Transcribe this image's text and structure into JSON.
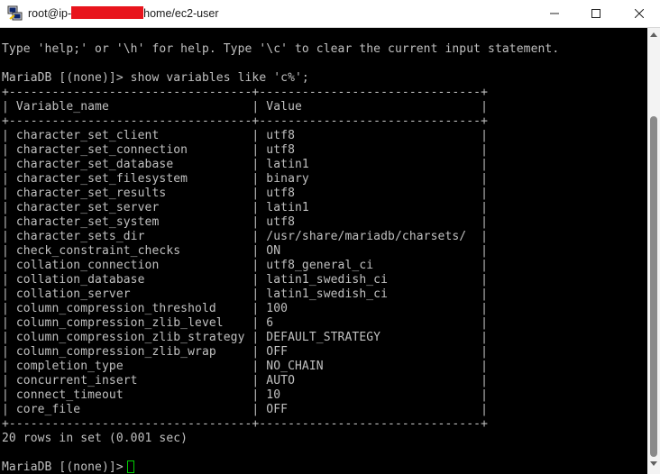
{
  "window": {
    "title_prefix": "root@ip-",
    "title_suffix": "home/ec2-user",
    "icon": "putty-icon"
  },
  "terminal": {
    "lines": [
      "",
      "Type 'help;' or '\\h' for help. Type '\\c' to clear the current input statement.",
      "",
      "MariaDB [(none)]> show variables like 'c%';",
      "+----------------------------------+-------------------------------+",
      "| Variable_name                    | Value                         |",
      "+----------------------------------+-------------------------------+",
      "| character_set_client             | utf8                          |",
      "| character_set_connection         | utf8                          |",
      "| character_set_database           | latin1                        |",
      "| character_set_filesystem         | binary                        |",
      "| character_set_results            | utf8                          |",
      "| character_set_server             | latin1                        |",
      "| character_set_system             | utf8                          |",
      "| character_sets_dir               | /usr/share/mariadb/charsets/  |",
      "| check_constraint_checks          | ON                            |",
      "| collation_connection             | utf8_general_ci               |",
      "| collation_database               | latin1_swedish_ci             |",
      "| collation_server                 | latin1_swedish_ci             |",
      "| column_compression_threshold     | 100                           |",
      "| column_compression_zlib_level    | 6                             |",
      "| column_compression_zlib_strategy | DEFAULT_STRATEGY              |",
      "| column_compression_zlib_wrap     | OFF                           |",
      "| completion_type                  | NO_CHAIN                      |",
      "| concurrent_insert                | AUTO                          |",
      "| connect_timeout                  | 10                            |",
      "| core_file                        | OFF                           |",
      "+----------------------------------+-------------------------------+",
      "20 rows in set (0.001 sec)",
      "",
      "MariaDB [(none)]>"
    ]
  },
  "colors": {
    "terminal_bg": "#000000",
    "terminal_fg": "#c0c0c0",
    "cursor": "#00d000",
    "redaction": "#e8141c"
  }
}
